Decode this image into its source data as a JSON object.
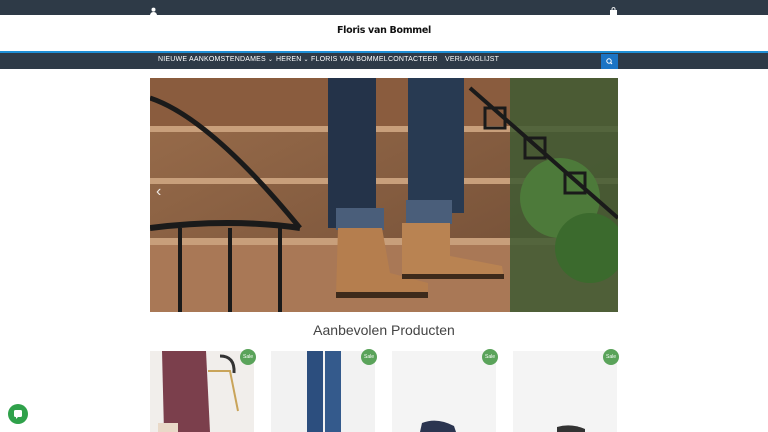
{
  "topbar": {
    "user_icon": "user-icon",
    "cart_icon": "shopping-bag-icon"
  },
  "header": {
    "logo_text": "Floris van Bommel"
  },
  "nav": {
    "items": [
      {
        "label": "NIEUWE AANKOMSTEN"
      },
      {
        "label": "DAMES",
        "has_dropdown": true
      },
      {
        "label": "HEREN",
        "has_dropdown": true
      },
      {
        "label": "FLORIS VAN BOMMEL"
      },
      {
        "label": "CONTACTEER"
      },
      {
        "label": "VERLANGLIJST"
      }
    ],
    "search_icon": "search-icon"
  },
  "hero": {
    "prev_arrow": "‹"
  },
  "featured": {
    "title": "Aanbevolen Producten",
    "products": [
      {
        "badge": "Sale"
      },
      {
        "badge": "Sale"
      },
      {
        "badge": "Sale"
      },
      {
        "badge": "Sale"
      }
    ]
  },
  "colors": {
    "nav_bg": "#2e3a47",
    "accent": "#1b74c4",
    "sale_badge": "#5aa35a",
    "chat": "#2fa14a"
  }
}
